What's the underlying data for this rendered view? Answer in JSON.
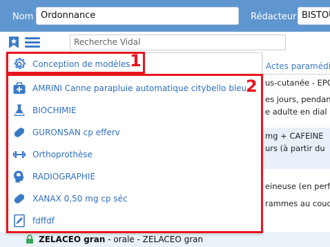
{
  "header": {
    "nom_label": "Nom",
    "nom_value": "Ordonnance",
    "redacteur_label": "Rédacteur",
    "redacteur_value": "BISTOU"
  },
  "toolbar": {
    "search_placeholder": "Recherche Vidal",
    "bookmark_icon": "bookmark-star-icon",
    "menu_icon": "hamburger-menu-icon"
  },
  "menu": {
    "design_item": "Conception de modèles",
    "items": [
      {
        "label": "AMRINI Canne parapluie automatique citybello bleu",
        "icon": "medical-kit-icon"
      },
      {
        "label": "BIOCHIMIE",
        "icon": "lab-flask-icon"
      },
      {
        "label": "GURONSAN cp efferv",
        "icon": "pill-icon"
      },
      {
        "label": "Orthoprothèse",
        "icon": "dumbbell-icon"
      },
      {
        "label": "RADIOGRAPHIE",
        "icon": "head-scan-icon"
      },
      {
        "label": "XANAX 0,50 mg cp séc",
        "icon": "pill-icon"
      },
      {
        "label": "fdffdf",
        "icon": "document-edit-icon"
      }
    ]
  },
  "annotations": {
    "marker_1": "1",
    "marker_2": "2"
  },
  "background": {
    "tab_label": "Actes paramédi",
    "lines": [
      "us-cutanée - EPO",
      "es jours, pendan",
      "e adulte en dial",
      "mg + CAFEINE",
      "urs (à partir du",
      "eineuse (en perf",
      "rammes au couc"
    ],
    "bottom_name": "ZELACEO gran",
    "bottom_rest": " - orale - ZELACEO gran"
  },
  "colors": {
    "header_blue": "#5f96d0",
    "accent_blue": "#3a79c6",
    "highlight_red": "#e8141e"
  }
}
